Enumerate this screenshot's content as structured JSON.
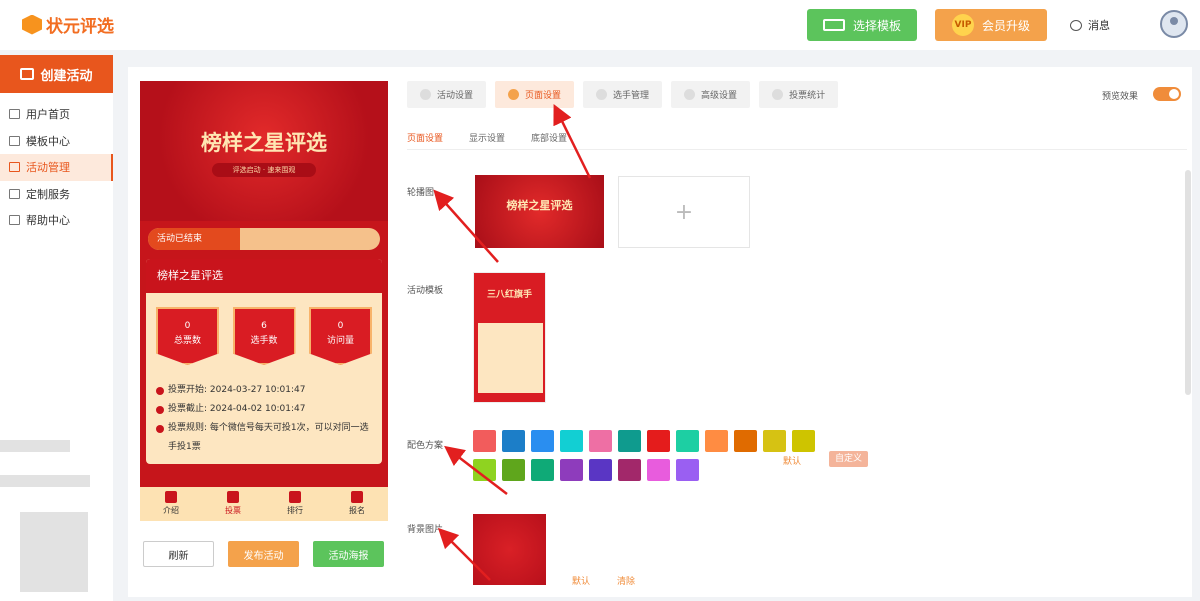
{
  "brand": {
    "name": "状元评选"
  },
  "header": {
    "select_template": "选择模板",
    "vip_badge": "VIP",
    "vip_upgrade": "会员升级",
    "message": "消息"
  },
  "sidebar": {
    "create": "创建活动",
    "items": [
      {
        "label": "用户首页"
      },
      {
        "label": "模板中心"
      },
      {
        "label": "活动管理"
      },
      {
        "label": "定制服务"
      },
      {
        "label": "帮助中心"
      }
    ],
    "active_index": 2
  },
  "phone": {
    "banner_title": "榜样之星评选",
    "banner_sub": "评选启动 · 速来围观",
    "status": "活动已结束",
    "card_title": "榜样之星评选",
    "stats": [
      {
        "value": "0",
        "label": "总票数"
      },
      {
        "value": "6",
        "label": "选手数"
      },
      {
        "value": "0",
        "label": "访问量"
      }
    ],
    "vote_start": "投票开始:  2024-03-27 10:01:47",
    "vote_end": "投票截止:  2024-04-02 10:01:47",
    "vote_rule": "投票规则:  每个微信号每天可投1次，可以对同一选手投1票",
    "tabs": [
      "介绍",
      "投票",
      "排行",
      "报名"
    ]
  },
  "actions": {
    "refresh": "刷新",
    "publish": "发布活动",
    "poster": "活动海报"
  },
  "tabs": [
    "活动设置",
    "页面设置",
    "选手管理",
    "高级设置",
    "投票统计"
  ],
  "preview_label": "预览效果",
  "subtabs": [
    "页面设置",
    "显示设置",
    "底部设置"
  ],
  "labels": {
    "carousel": "轮播图",
    "template": "活动模板",
    "color_scheme": "配色方案",
    "background": "背景图片"
  },
  "carousel_text": "榜样之星评选",
  "template_text": "三八红旗手",
  "colors": [
    "#f25c5c",
    "#1c7ec8",
    "#2a8ef0",
    "#12cfd3",
    "#ee6fa4",
    "#0f9b8e",
    "#e41c1c",
    "#1dcfa3",
    "#ff8c42",
    "#e06b00",
    "#d6c213",
    "#cec400",
    "#8fd320",
    "#5fa61c",
    "#0faa77",
    "#8e3cbc",
    "#5a36c4",
    "#a2286a",
    "#e85cdd",
    "#9a5ff2"
  ],
  "color_default": "默认",
  "color_custom": "自定义",
  "bg_default": "默认",
  "bg_clear": "清除"
}
